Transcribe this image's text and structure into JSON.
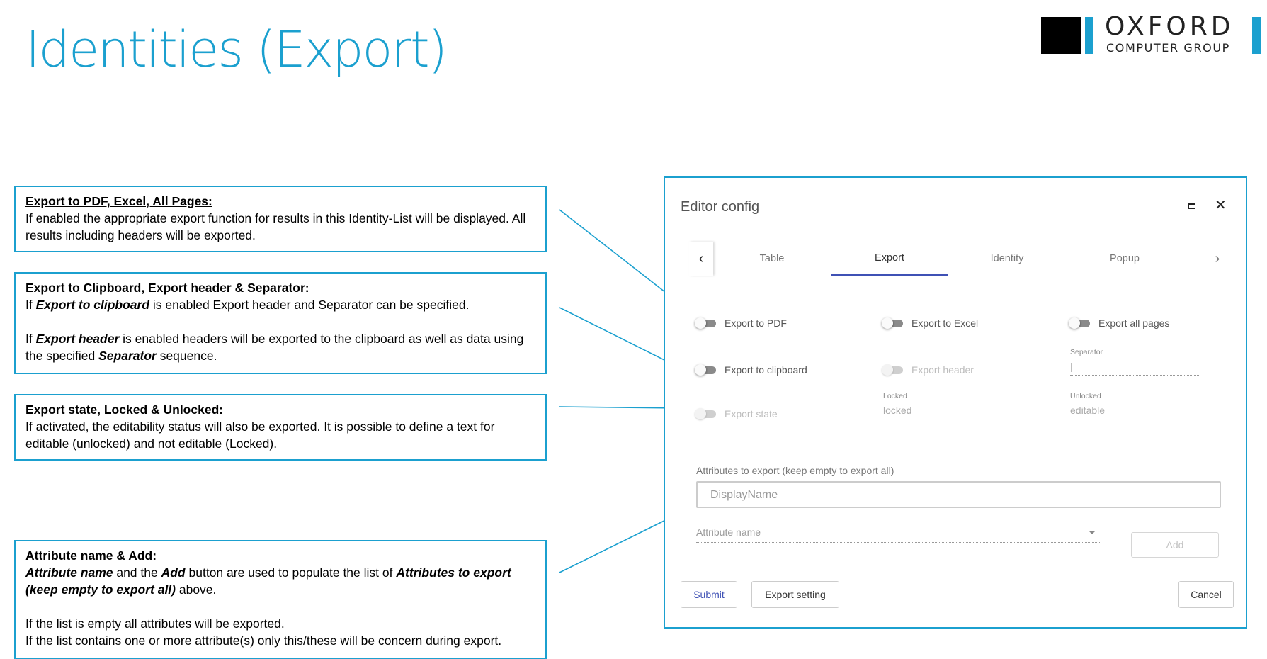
{
  "slide": {
    "title": "Identities (Export)"
  },
  "logo": {
    "main": "OXFORD",
    "sub": "COMPUTER GROUP"
  },
  "callouts": {
    "c1": {
      "title": "Export to PDF, Excel, All Pages:",
      "line1": "If enabled the appropriate export function for results in this Identity-List will be displayed. All results including headers will be exported."
    },
    "c2": {
      "title": "Export to Clipboard, Export header & Separator:",
      "p1_a": "If ",
      "p1_b": "Export to clipboard",
      "p1_c": " is enabled Export header and Separator can be specified.",
      "p2_a": "If ",
      "p2_b": "Export header",
      "p2_c": " is enabled headers will be exported to the clipboard as well as data using the specified ",
      "p2_d": "Separator",
      "p2_e": " sequence."
    },
    "c3": {
      "title": "Export state, Locked & Unlocked:",
      "line1": "If activated, the editability status will also be exported. It is possible to define a text for editable (unlocked) and not editable (Locked)."
    },
    "c4": {
      "title": "Attribute name & Add:",
      "p1_a": "Attribute name",
      "p1_b": " and the ",
      "p1_c": "Add",
      "p1_d": " button are used to populate the list of ",
      "p1_e": "Attributes to export (keep empty to export all)",
      "p1_f": " above.",
      "p2": "If the list is empty all attributes will be exported.",
      "p3": "If the list contains one or more attribute(s) only this/these will be concern during export."
    }
  },
  "dialog": {
    "title": "Editor config",
    "tabs": [
      "Table",
      "Export",
      "Identity",
      "Popup"
    ],
    "active_tab": "Export",
    "toggles": {
      "export_pdf": "Export to PDF",
      "export_excel": "Export to Excel",
      "export_all_pages": "Export all pages",
      "export_clipboard": "Export to clipboard",
      "export_header": "Export header",
      "export_state": "Export state"
    },
    "fields": {
      "separator_label": "Separator",
      "separator_value": "|",
      "locked_label": "Locked",
      "locked_value": "locked",
      "unlocked_label": "Unlocked",
      "unlocked_value": "editable"
    },
    "attributes_label": "Attributes to export (keep empty to export all)",
    "attributes_value": "DisplayName",
    "attribute_name_placeholder": "Attribute name",
    "buttons": {
      "add": "Add",
      "submit": "Submit",
      "export_setting": "Export setting",
      "cancel": "Cancel"
    }
  },
  "colors": {
    "accent": "#1ba0cf",
    "tab_indicator": "#3f51b5"
  }
}
